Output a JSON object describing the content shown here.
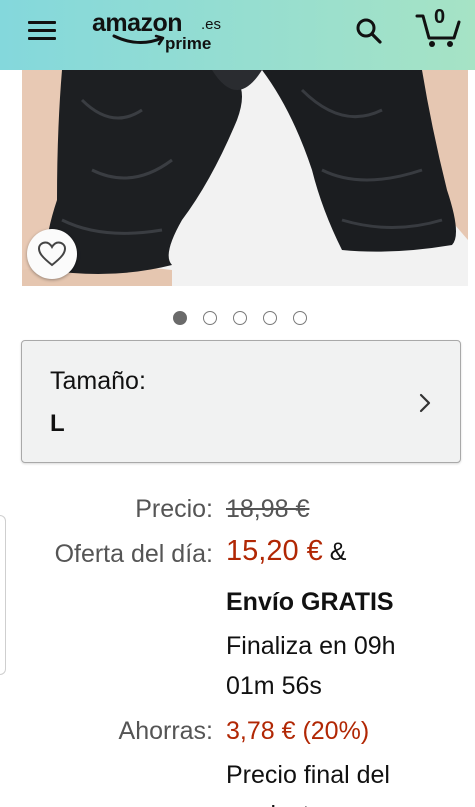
{
  "header": {
    "logo_word": "amazon",
    "logo_tld": ".es",
    "logo_sub": "prime",
    "cart_count": "0",
    "gradient_start": "#84d8dc",
    "gradient_end": "#a6e3c5",
    "menu_icon": "hamburger-menu-icon",
    "search_icon": "search-icon",
    "cart_icon": "cart-icon"
  },
  "gallery": {
    "image_count": 5,
    "active_index": 0,
    "wishlist_icon": "heart-icon"
  },
  "size_selector": {
    "label": "Tamaño:",
    "value": "L"
  },
  "pricing": {
    "list_price_label": "Precio:",
    "list_price": "18,98 €",
    "deal_label": "Oferta del día:",
    "deal_price": "15,20 €",
    "amp": "&",
    "shipping": "Envío GRATIS",
    "ends_line1": "Finaliza en 09h",
    "ends_line2": "01m 56s",
    "savings_label": "Ahorras:",
    "savings_value": "3,78 € (20%)",
    "final_price_line1": "Precio final del",
    "final_price_line2": "producto",
    "accent_color": "#b12704"
  }
}
